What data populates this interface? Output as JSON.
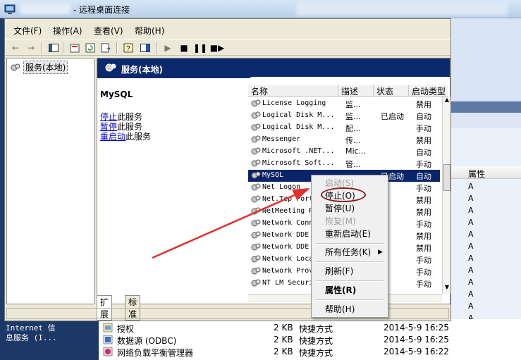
{
  "window": {
    "title": "- 远程桌面连接"
  },
  "menubar": [
    "文件(F)",
    "操作(A)",
    "查看(V)",
    "帮助(H)"
  ],
  "tree": {
    "root_label": "服务(本地)"
  },
  "header": {
    "title": "服务(本地)"
  },
  "detail": {
    "service_name": "MySQL",
    "actions": [
      {
        "link": "停止",
        "rest": "此服务"
      },
      {
        "link": "暂停",
        "rest": "此服务"
      },
      {
        "link": "重启动",
        "rest": "此服务"
      }
    ]
  },
  "columns": {
    "name": "名称",
    "desc": "描述",
    "status": "状态",
    "startup": "启动类型"
  },
  "services": [
    {
      "name": "License Logging",
      "desc": "监...",
      "status": "",
      "startup": "禁用"
    },
    {
      "name": "Logical Disk M...",
      "desc": "监...",
      "status": "已启动",
      "startup": "自动"
    },
    {
      "name": "Logical Disk M...",
      "desc": "配...",
      "status": "",
      "startup": "手动"
    },
    {
      "name": "Messenger",
      "desc": "传...",
      "status": "",
      "startup": "禁用"
    },
    {
      "name": "Microsoft .NET...",
      "desc": "Mic...",
      "status": "",
      "startup": "自动"
    },
    {
      "name": "Microsoft Soft...",
      "desc": "管...",
      "status": "",
      "startup": "手动"
    },
    {
      "name": "MySQL",
      "desc": "",
      "status": "已启动",
      "startup": "自动"
    },
    {
      "name": "Net Logon",
      "desc": "",
      "status": "",
      "startup": "手动"
    },
    {
      "name": "Net.Tcp Port",
      "desc": "",
      "status": "",
      "startup": "禁用"
    },
    {
      "name": "NetMeeting Re",
      "desc": "",
      "status": "",
      "startup": "禁用"
    },
    {
      "name": "Network Conn",
      "desc": "",
      "status": "",
      "startup": "手动"
    },
    {
      "name": "Network DDE",
      "desc": "",
      "status": "",
      "startup": "禁用"
    },
    {
      "name": "Network DDE",
      "desc": "",
      "status": "",
      "startup": "禁用"
    },
    {
      "name": "Network Loca",
      "desc": "",
      "status": "",
      "startup": "手动"
    },
    {
      "name": "Network Prov",
      "desc": "",
      "status": "",
      "startup": "手动"
    },
    {
      "name": "NT LM Securi",
      "desc": "",
      "status": "",
      "startup": "手动"
    }
  ],
  "tabs": [
    "扩展",
    "标准"
  ],
  "context_menu": {
    "start": "启动(S)",
    "stop": "停止(O)",
    "pause": "暂停(U)",
    "resume": "恢复(M)",
    "restart": "重新启动(E)",
    "all_tasks": "所有任务(K)",
    "refresh": "刷新(F)",
    "properties": "属性(R)",
    "help": "帮助(H)"
  },
  "background": {
    "attr_header": "属性",
    "attr_values": [
      "A",
      "A",
      "A",
      "A",
      "A",
      "A",
      "A",
      "A",
      "A",
      "A",
      "A",
      "A",
      "A",
      "A",
      "A"
    ],
    "left_lines": [
      "Internet 信",
      "息服务 (I..."
    ],
    "files": [
      {
        "name": "授权",
        "size": "2 KB",
        "type": "快捷方式",
        "date": "2014-5-9 16:25"
      },
      {
        "name": "数据源 (ODBC)",
        "size": "2 KB",
        "type": "快捷方式",
        "date": "2014-5-9 16:25"
      },
      {
        "name": "网络负载平衡管理器",
        "size": "2 KB",
        "type": "快捷方式",
        "date": "2014-5-9 16:22"
      }
    ]
  },
  "colors": {
    "header_bg": "#0b2a6e",
    "selection": "#0a246a",
    "annotation": "#8b1a1a",
    "arrow": "#e03030"
  }
}
